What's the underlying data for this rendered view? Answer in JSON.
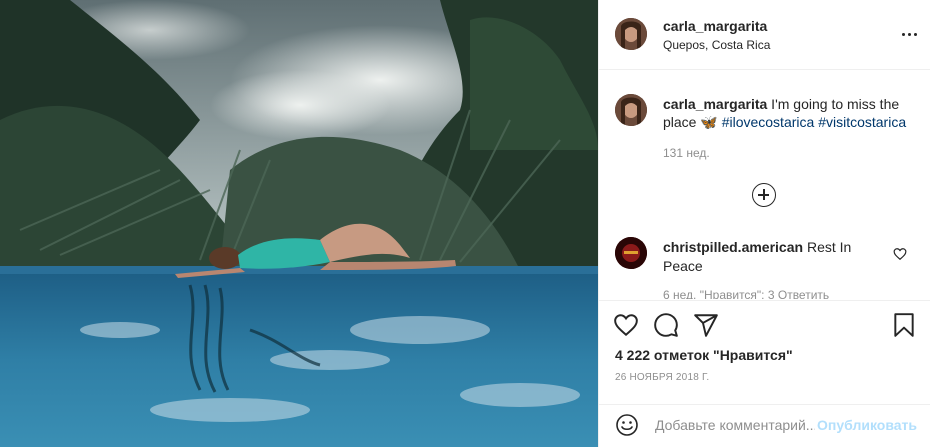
{
  "post": {
    "photo_icon": "photo-pool-woman",
    "author": {
      "username": "carla_margarita",
      "location": "Quepos, Costa Rica"
    },
    "caption": {
      "username": "carla_margarita",
      "text": " I'm going to miss the place 🦋 ",
      "tags": [
        "#ilovecostarica",
        "#visitcostarica"
      ],
      "time": "131 нед."
    },
    "comments": [
      {
        "username": "christpilled.american",
        "text": " Rest In Peace",
        "meta": "6 нед.   \"Нравится\": 3   Ответить"
      }
    ],
    "likes": "4 222 отметок \"Нравится\"",
    "date": "26 НОЯБРЯ 2018 Г.",
    "add_comment": {
      "placeholder": "Добавьте комментарий...",
      "publish_label": "Опубликовать"
    }
  },
  "icons": [
    "more-icon",
    "load-more-icon",
    "heart-icon",
    "comment-icon",
    "share-icon",
    "bookmark-icon",
    "emoji-icon"
  ],
  "colors": {
    "text": "#262626",
    "muted": "#8e8e8e",
    "hashtag": "#00376b",
    "publish_disabled": "#b2dffc",
    "border": "#efefef"
  }
}
